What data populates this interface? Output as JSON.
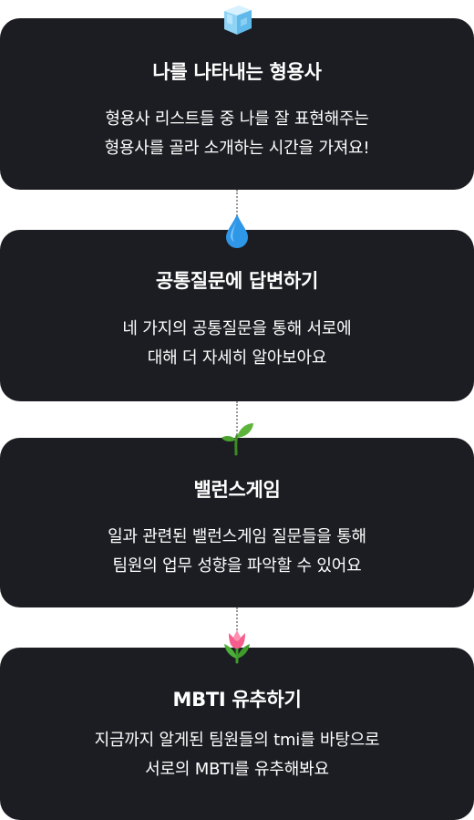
{
  "steps": [
    {
      "icon": "ice-cube-icon",
      "title": "나를 나타내는 형용사",
      "description": [
        "형용사 리스트들 중 나를 잘 표현해주는",
        "형용사를 골라 소개하는 시간을 가져요!"
      ]
    },
    {
      "icon": "water-drop-icon",
      "title": "공통질문에 답변하기",
      "description": [
        "네 가지의 공통질문을 통해 서로에",
        "대해 더 자세히 알아보아요"
      ]
    },
    {
      "icon": "seedling-icon",
      "title": "밸런스게임",
      "description": [
        "일과 관련된 밸런스게임 질문들을 통해",
        "팀원의 업무 성향을 파악할 수 있어요"
      ]
    },
    {
      "icon": "tulip-icon",
      "title": "MBTI 유추하기",
      "description": [
        "지금까지 알게된 팀원들의 tmi를 바탕으로",
        "서로의 MBTI를 유추해봐요"
      ]
    }
  ],
  "colors": {
    "card_background": "#1c1d22",
    "card_text": "#ffffff",
    "page_background": "#ffffff",
    "connector": "#9b9b9b"
  }
}
